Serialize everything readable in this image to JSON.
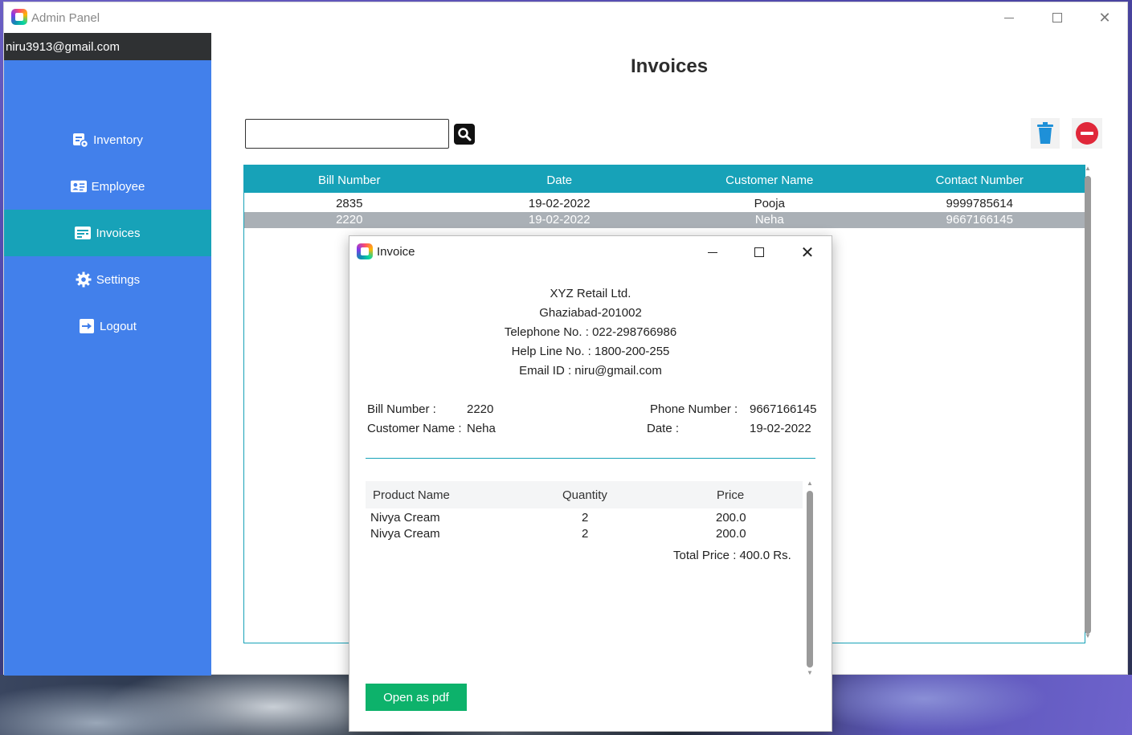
{
  "window": {
    "title": "Admin Panel"
  },
  "user": {
    "email": "niru3913@gmail.com"
  },
  "sidebar": {
    "items": [
      {
        "label": "Inventory",
        "icon": "inventory-icon"
      },
      {
        "label": "Employee",
        "icon": "id-card-icon"
      },
      {
        "label": "Invoices",
        "icon": "invoice-icon",
        "active": true
      },
      {
        "label": "Settings",
        "icon": "gear-icon"
      },
      {
        "label": "Logout",
        "icon": "logout-icon"
      }
    ]
  },
  "page": {
    "title": "Invoices",
    "search_value": ""
  },
  "table": {
    "columns": [
      "Bill Number",
      "Date",
      "Customer Name",
      "Contact Number"
    ],
    "rows": [
      [
        "2835",
        "19-02-2022",
        "Pooja",
        "9999785614"
      ],
      [
        "2220",
        "19-02-2022",
        "Neha",
        "9667166145"
      ]
    ],
    "selected_row": 1
  },
  "dialog": {
    "title": "Invoice",
    "company": {
      "name": "XYZ Retail Ltd.",
      "address": "Ghaziabad-201002",
      "telephone": "Telephone No. : 022-298766986",
      "helpline": "Help Line No. : 1800-200-255",
      "email": "Email ID : niru@gmail.com"
    },
    "info": {
      "bill_label": "Bill Number :",
      "bill_value": "2220",
      "customer_label": "Customer Name :",
      "customer_value": "Neha",
      "phone_label": "Phone Number :",
      "phone_value": "9667166145",
      "date_label": "Date :",
      "date_value": "19-02-2022"
    },
    "items_columns": [
      "Product Name",
      "Quantity",
      "Price"
    ],
    "items": [
      [
        "Nivya Cream",
        "2",
        "200.0"
      ],
      [
        "Nivya Cream",
        "2",
        "200.0"
      ]
    ],
    "total": "Total Price : 400.0 Rs.",
    "pdf_button": "Open as pdf"
  },
  "colors": {
    "sidebar": "#4280eb",
    "active": "#17a2b8",
    "header": "#17a2b8",
    "pdf_button": "#0db26b",
    "delete_icon": "#1e90d8",
    "remove_icon": "#e0283a"
  }
}
